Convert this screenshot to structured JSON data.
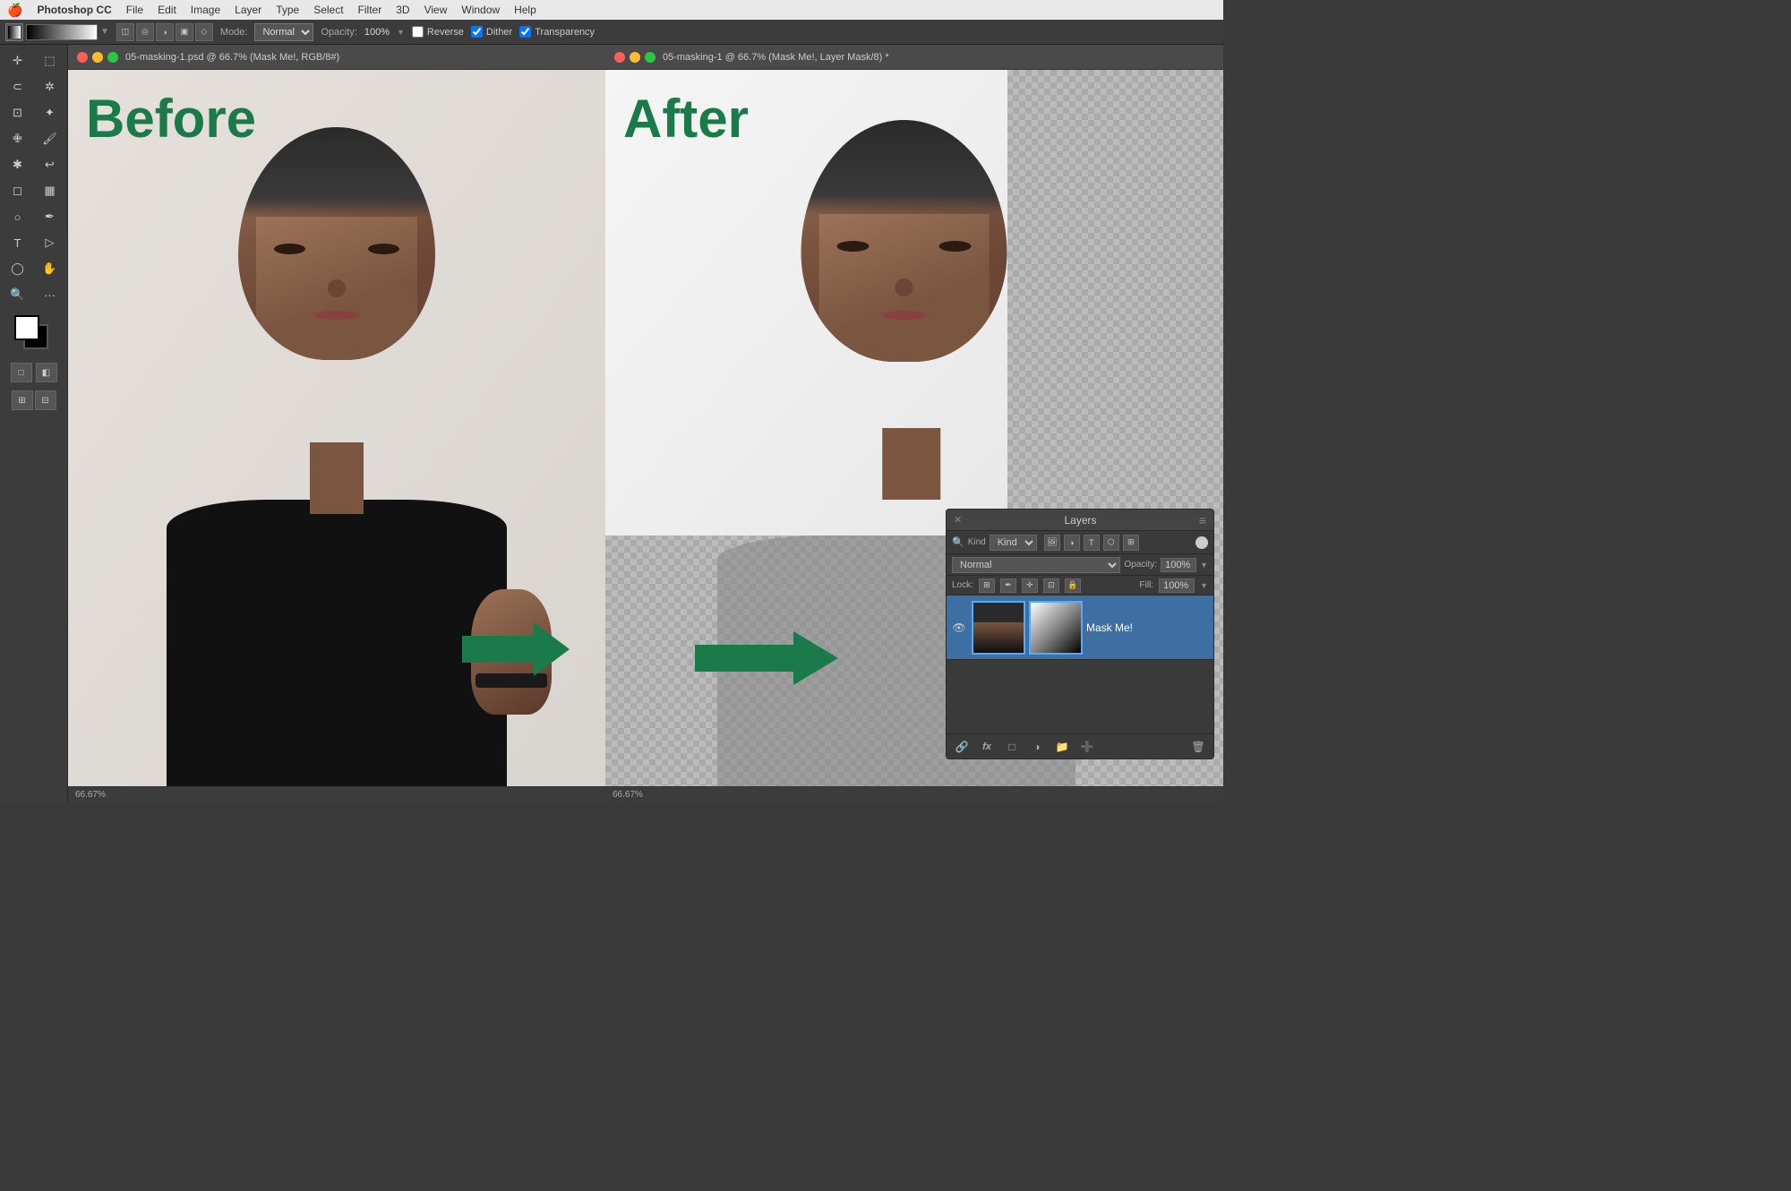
{
  "menubar": {
    "apple": "🍎",
    "app_name": "Photoshop CC",
    "items": [
      "File",
      "Edit",
      "Image",
      "Layer",
      "Type",
      "Select",
      "Filter",
      "3D",
      "View",
      "Window",
      "Help"
    ]
  },
  "toolbar": {
    "mode_label": "Mode:",
    "mode_value": "Normal",
    "opacity_label": "Opacity:",
    "opacity_value": "100%",
    "reverse_label": "Reverse",
    "dither_label": "Dither",
    "transparency_label": "Transparency"
  },
  "before_doc": {
    "tab_title": "05-masking-1.psd @ 66.7% (Mask Me!, RGB/8#)",
    "status": "66.67%",
    "canvas_label": "Before"
  },
  "after_doc": {
    "tab_title": "05-masking-1 @ 66.7% (Mask Me!, Layer Mask/8) *",
    "status": "66.67%",
    "canvas_label": "After"
  },
  "layers_panel": {
    "title": "Layers",
    "close_icon": "✕",
    "menu_icon": "≡",
    "filter_label": "Kind",
    "blend_mode": "Normal",
    "opacity_label": "Opacity:",
    "opacity_value": "100%",
    "fill_label": "Fill:",
    "fill_value": "100%",
    "lock_label": "Lock:",
    "layer_name": "Mask Me!",
    "bottom_buttons": [
      "🔗",
      "fx",
      "□",
      "○",
      "📁",
      "➕",
      "🗑"
    ]
  }
}
